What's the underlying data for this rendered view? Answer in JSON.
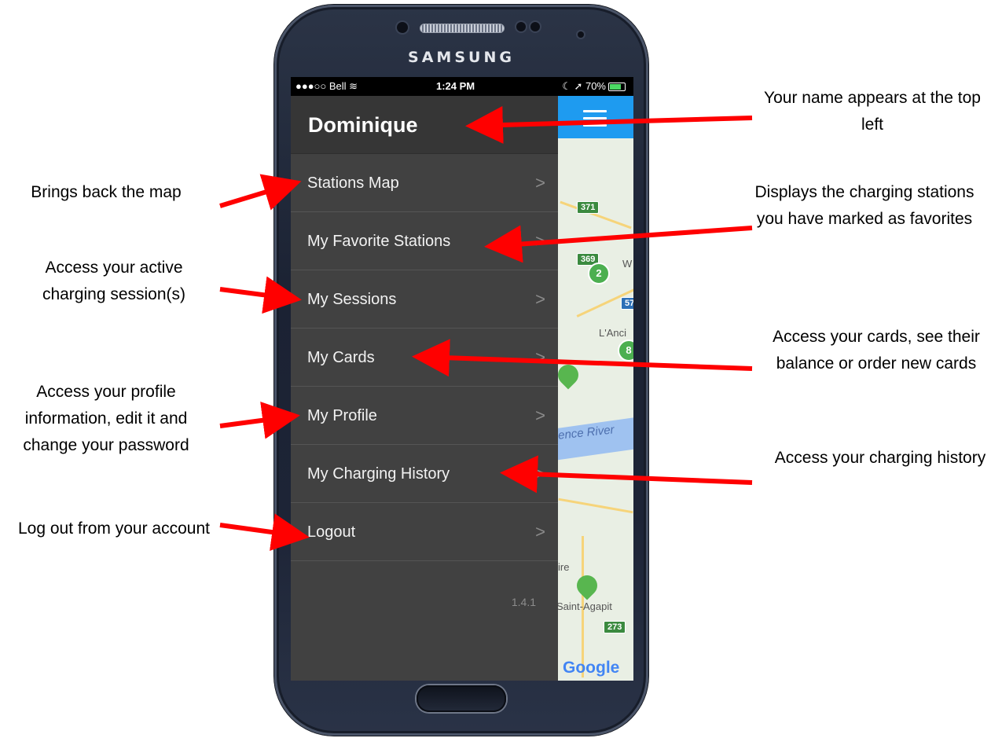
{
  "device": {
    "brand": "SAMSUNG"
  },
  "status_bar": {
    "carrier": "●●●○○ Bell ≋",
    "time": "1:24 PM",
    "status": "☾ ➚ 70%"
  },
  "drawer": {
    "user_name": "Dominique",
    "items": [
      {
        "label": "Stations Map",
        "chevron": ">"
      },
      {
        "label": "My Favorite Stations",
        "chevron": ">"
      },
      {
        "label": "My Sessions",
        "chevron": ">"
      },
      {
        "label": "My Cards",
        "chevron": ">"
      },
      {
        "label": "My Profile",
        "chevron": ">"
      },
      {
        "label": "My Charging History",
        "chevron": ">"
      },
      {
        "label": "Logout",
        "chevron": ">"
      }
    ],
    "version": "1.4.1"
  },
  "map": {
    "river_label": "ence River",
    "labels": [
      "L'Anci",
      "ire",
      "Saint-Agapit",
      "W"
    ],
    "shields": [
      "371",
      "369",
      "57",
      "273"
    ],
    "clusters": [
      "2",
      "8"
    ],
    "google": "Google"
  },
  "annotations": {
    "name": "Your name appears at the top left",
    "map": "Brings back the map",
    "favorites": "Displays the charging stations you have marked as favorites",
    "sessions": "Access your active charging session(s)",
    "cards": "Access your cards, see their balance or order new cards",
    "profile": "Access your profile information, edit it and change your password",
    "history": "Access your charging history",
    "logout": "Log out from your account"
  },
  "colors": {
    "drawer_bg": "#414141",
    "header_bg": "#363636",
    "map_bar": "#1e9bf0",
    "arrow": "#ff0000"
  }
}
